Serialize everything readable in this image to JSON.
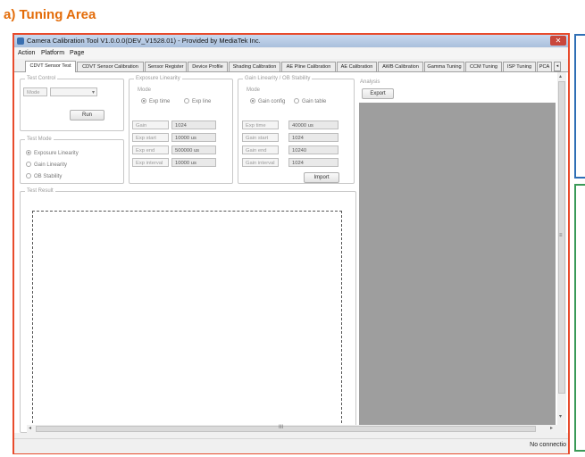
{
  "caption": "a) Tuning Area",
  "window": {
    "title": "Camera Calibration Tool V1.0.0.0(DEV_V1528.01) - Provided by MediaTek Inc.",
    "close_glyph": "✕"
  },
  "menu": [
    "Action",
    "Platform",
    "Page"
  ],
  "tabs": [
    "CDVT Sensor Test",
    "CDVT Sensor Calibration",
    "Sensor Register",
    "Device Profile",
    "Shading Calibration",
    "AE Pline Calibration",
    "AE Calibration",
    "AWB Calibration",
    "Gamma Tuning",
    "CCM Tuning",
    "ISP Tuning",
    "PCA"
  ],
  "tab_arrows": [
    "◂",
    "▸"
  ],
  "test_control": {
    "legend": "Test Control",
    "mode_label": "Mode",
    "mode_arrow": "▾",
    "run_button": "Run"
  },
  "exposure_linearity": {
    "legend": "Exposure Linearity",
    "mode_label": "Mode",
    "radios": [
      "Exp time",
      "Exp line"
    ],
    "rows": [
      {
        "label": "Gain",
        "value": "1024"
      },
      {
        "label": "Exp start",
        "value": "10000 us"
      },
      {
        "label": "Exp end",
        "value": "500000 us"
      },
      {
        "label": "Exp interval",
        "value": "10000 us"
      }
    ]
  },
  "gain_linearity": {
    "legend": "Gain Linearity / OB Stability",
    "mode_label": "Mode",
    "radios": [
      "Gain config",
      "Gain table"
    ],
    "rows": [
      {
        "label": "Exp time",
        "value": "40000 us"
      },
      {
        "label": "Gain start",
        "value": "1024"
      },
      {
        "label": "Gain end",
        "value": "10240"
      },
      {
        "label": "Gain interval",
        "value": "1024"
      }
    ],
    "import_button": "Import"
  },
  "test_mode": {
    "legend": "Test Mode",
    "options": [
      "Exposure Linearity",
      "Gain Linearity",
      "OB Stability"
    ],
    "selected": "Exposure Linearity"
  },
  "test_result": {
    "legend": "Test Result"
  },
  "analysis": {
    "legend": "Analysis",
    "export_button": "Export"
  },
  "scrollbar": {
    "up": "▴",
    "down": "▾",
    "left": "◂",
    "right": "▸",
    "grip": "≡",
    "hgrip": "III"
  },
  "status": {
    "text": "No connectio"
  },
  "colors": {
    "caption": "#e36c09",
    "tuning_border": "#e84b2c",
    "blue_border": "#2f6fb5",
    "green_border": "#3a9a58",
    "analysis_bg": "#9e9e9e"
  }
}
